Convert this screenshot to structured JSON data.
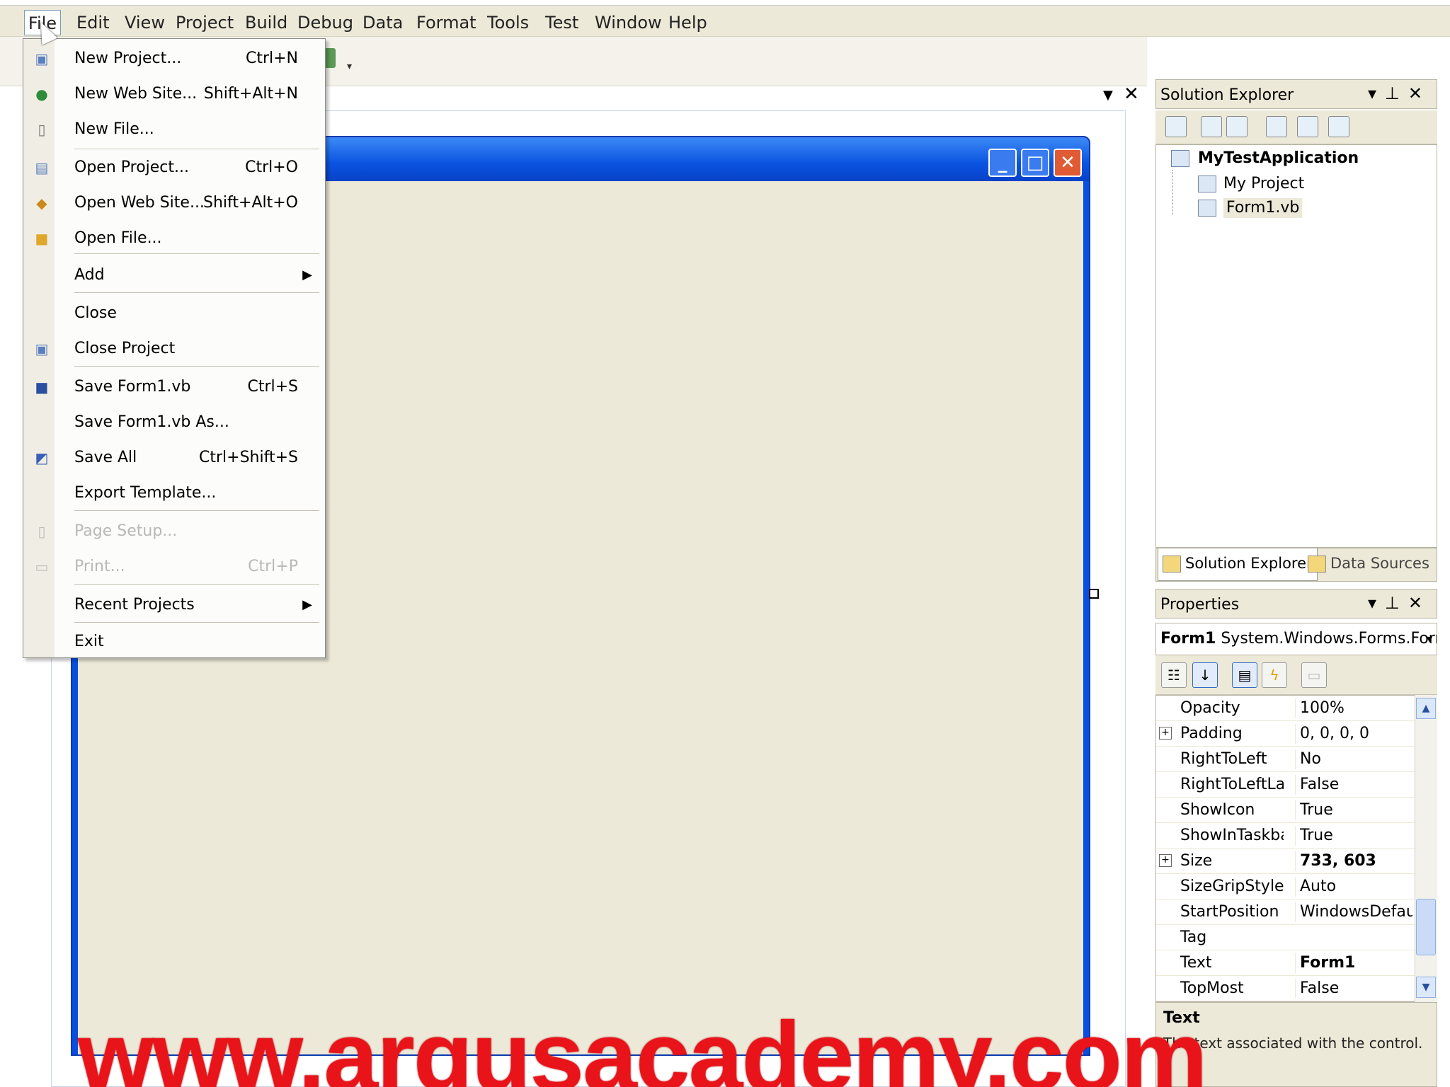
{
  "menubar": {
    "items": [
      "File",
      "Edit",
      "View",
      "Project",
      "Build",
      "Debug",
      "Data",
      "Format",
      "Tools",
      "Test",
      "Window",
      "Help"
    ]
  },
  "file_menu": {
    "items": [
      {
        "label": "New Project...",
        "shortcut": "Ctrl+N",
        "icon": "new-project-icon"
      },
      {
        "label": "New Web Site...",
        "shortcut": "Shift+Alt+N",
        "icon": "globe-icon"
      },
      {
        "label": "New File...",
        "shortcut": "",
        "icon": "new-file-icon"
      },
      {
        "label": "Open Project...",
        "shortcut": "Ctrl+O",
        "icon": "open-project-icon"
      },
      {
        "label": "Open Web Site...",
        "shortcut": "Shift+Alt+O",
        "icon": "open-web-site-icon"
      },
      {
        "label": "Open File...",
        "shortcut": "",
        "icon": "folder-open-icon"
      },
      {
        "label": "Add",
        "shortcut": "",
        "submenu": true
      },
      {
        "label": "Close",
        "shortcut": ""
      },
      {
        "label": "Close Project",
        "shortcut": "",
        "icon": "close-project-icon"
      },
      {
        "label": "Save Form1.vb",
        "shortcut": "Ctrl+S",
        "icon": "save-icon"
      },
      {
        "label": "Save Form1.vb As...",
        "shortcut": ""
      },
      {
        "label": "Save All",
        "shortcut": "Ctrl+Shift+S",
        "icon": "save-all-icon"
      },
      {
        "label": "Export Template...",
        "shortcut": ""
      },
      {
        "label": "Page Setup...",
        "shortcut": "",
        "disabled": true,
        "icon": "page-setup-icon"
      },
      {
        "label": "Print...",
        "shortcut": "Ctrl+P",
        "disabled": true,
        "icon": "printer-icon"
      },
      {
        "label": "Recent Projects",
        "shortcut": "",
        "submenu": true
      },
      {
        "label": "Exit",
        "shortcut": ""
      }
    ]
  },
  "solution_explorer": {
    "title": "Solution Explorer",
    "solution": "MyTestApplication",
    "children": [
      "My Project",
      "Form1.vb"
    ],
    "tabs": [
      "Solution Explorer",
      "Data Sources"
    ]
  },
  "properties": {
    "title": "Properties",
    "object_name": "Form1",
    "object_type": "System.Windows.Forms.Form",
    "rows": [
      {
        "name": "Opacity",
        "value": "100%"
      },
      {
        "name": "Padding",
        "value": "0, 0, 0, 0",
        "expandable": true
      },
      {
        "name": "RightToLeft",
        "value": "No"
      },
      {
        "name": "RightToLeftLayout",
        "value": "False"
      },
      {
        "name": "ShowIcon",
        "value": "True"
      },
      {
        "name": "ShowInTaskbar",
        "value": "True"
      },
      {
        "name": "Size",
        "value": "733, 603",
        "expandable": true,
        "bold": true
      },
      {
        "name": "SizeGripStyle",
        "value": "Auto"
      },
      {
        "name": "StartPosition",
        "value": "WindowsDefaultLocation"
      },
      {
        "name": "Tag",
        "value": ""
      },
      {
        "name": "Text",
        "value": "Form1",
        "bold": true
      },
      {
        "name": "TopMost",
        "value": "False"
      }
    ],
    "description": {
      "title": "Text",
      "text": "The text associated with the control."
    }
  },
  "watermark": "www.argusacademy.com",
  "colors": {
    "xp_title_blue": "#0a53e0",
    "close_red": "#e05a34",
    "form_client": "#ece9d8",
    "watermark_red": "#e8141a"
  }
}
